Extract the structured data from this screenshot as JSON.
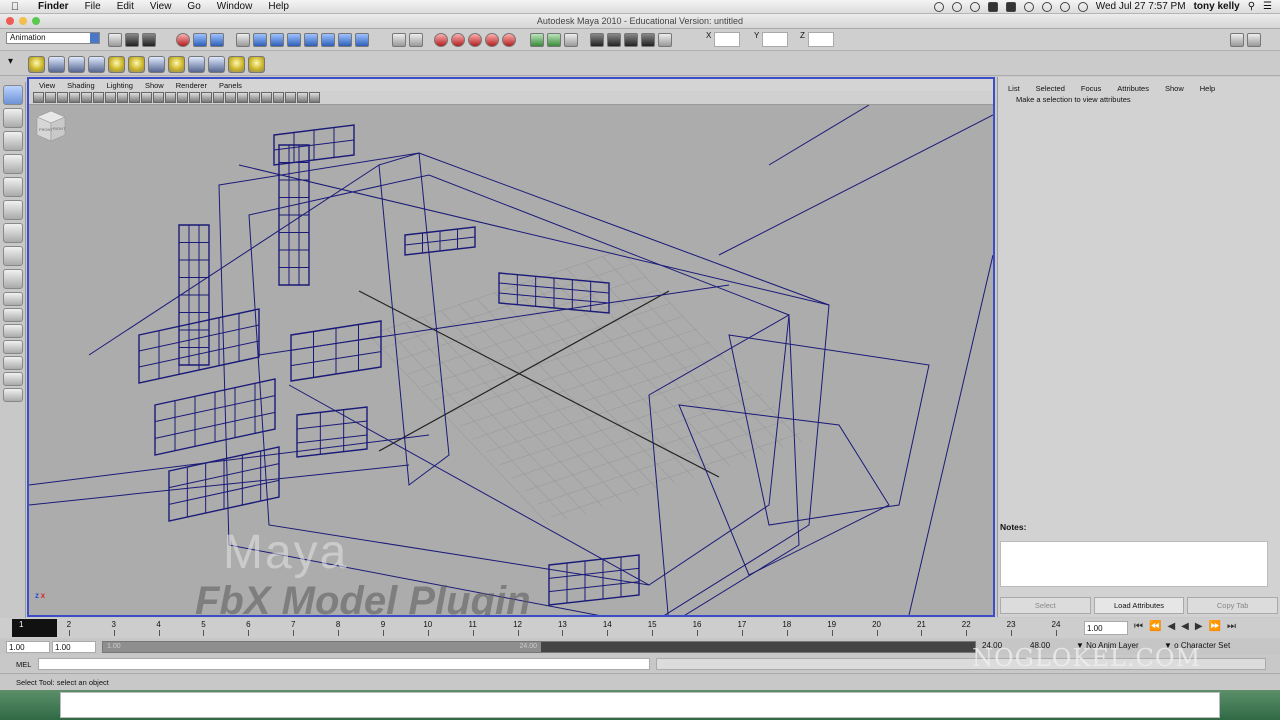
{
  "macbar": {
    "app": "Finder",
    "menus": [
      "File",
      "Edit",
      "View",
      "Go",
      "Window",
      "Help"
    ],
    "datetime": "Wed Jul 27  7:57 PM",
    "user": "tony kelly"
  },
  "window": {
    "title": "Autodesk Maya 2010 - Educational Version: untitled"
  },
  "statusline": {
    "mode": "Animation",
    "x_label": "X",
    "y_label": "Y",
    "z_label": "Z"
  },
  "panel": {
    "menus": [
      "View",
      "Shading",
      "Lighting",
      "Show",
      "Renderer",
      "Panels"
    ]
  },
  "attr_editor": {
    "menus": [
      "List",
      "Selected",
      "Focus",
      "Attributes",
      "Show",
      "Help"
    ],
    "message": "Make a selection to view attributes",
    "notes_label": "Notes:",
    "buttons": {
      "select": "Select",
      "load": "Load Attributes",
      "copy": "Copy Tab"
    }
  },
  "timeline": {
    "current_frame": "1",
    "ticks": [
      "1",
      "2",
      "3",
      "4",
      "5",
      "6",
      "7",
      "8",
      "9",
      "10",
      "11",
      "12",
      "13",
      "14",
      "15",
      "16",
      "17",
      "18",
      "19",
      "20",
      "21",
      "22",
      "23",
      "24"
    ],
    "current_time": "1.00"
  },
  "range": {
    "start": "1.00",
    "inner_start": "1.00",
    "bar_start": "1.00",
    "bar_end": "24.00",
    "end_inner": "24.00",
    "end": "48.00",
    "anim_layer": "No Anim Layer",
    "char_set": "o Character Set"
  },
  "cmdline": {
    "label": "MEL"
  },
  "helpline": {
    "text": "Select Tool: select an object"
  },
  "watermarks": {
    "maya": "Maya",
    "plugin": "FbX Model Plugin",
    "site": "NOGLOKEL.COM"
  },
  "viewport": {
    "axis": "z x",
    "cube_front": "FRONT",
    "cube_right": "RIGHT"
  },
  "colors": {
    "wire": "#1a1a78",
    "panel_border": "#3b4dc8",
    "viewport_bg": "#acacac"
  }
}
